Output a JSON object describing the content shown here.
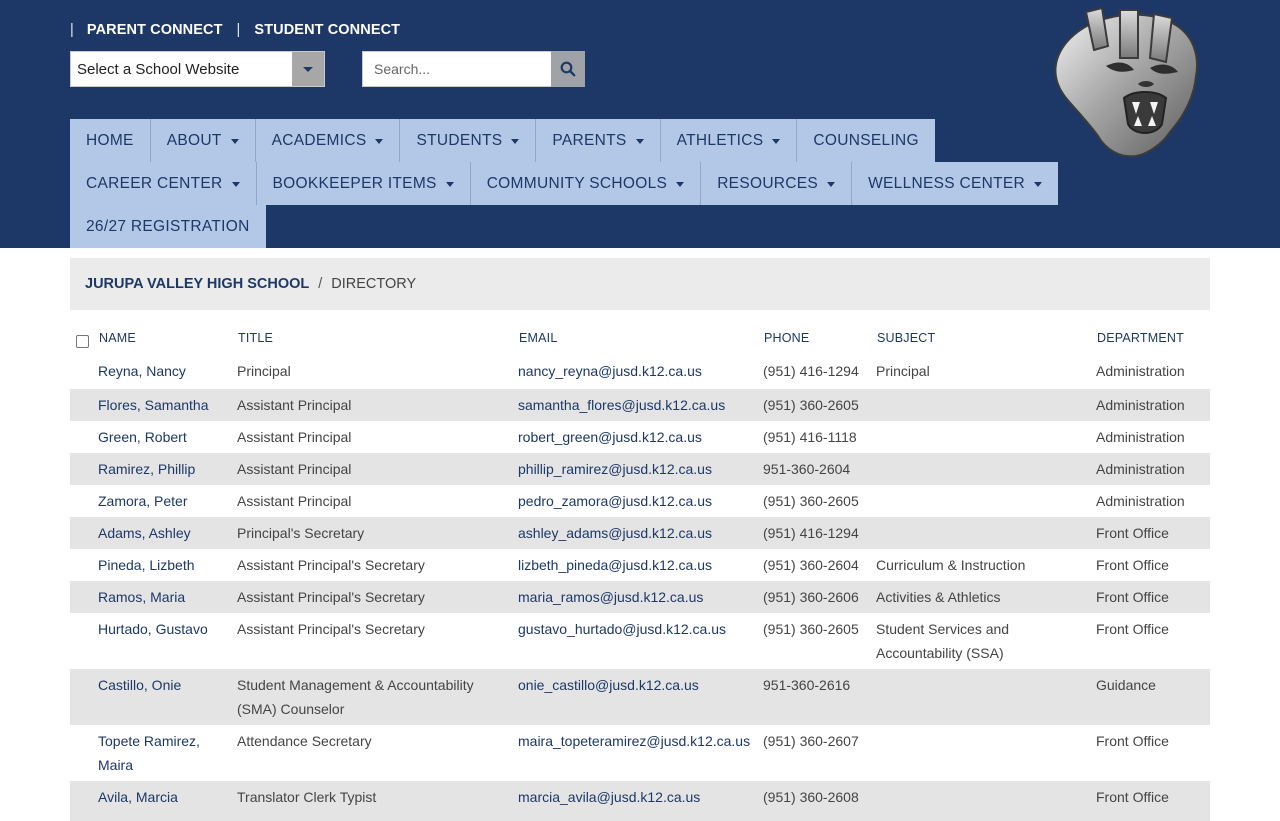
{
  "top_links": {
    "parent_connect": "PARENT CONNECT",
    "student_connect": "STUDENT CONNECT",
    "separator": "|"
  },
  "school_select": {
    "label": "Select a School Website"
  },
  "search": {
    "placeholder": "Search..."
  },
  "nav": {
    "row1": [
      {
        "label": "HOME",
        "dropdown": false
      },
      {
        "label": "ABOUT",
        "dropdown": true
      },
      {
        "label": "ACADEMICS",
        "dropdown": true
      },
      {
        "label": "STUDENTS",
        "dropdown": true
      },
      {
        "label": "PARENTS",
        "dropdown": true
      },
      {
        "label": "ATHLETICS",
        "dropdown": true
      },
      {
        "label": "COUNSELING",
        "dropdown": false
      }
    ],
    "row2": [
      {
        "label": "CAREER CENTER",
        "dropdown": true
      },
      {
        "label": "BOOKKEEPER ITEMS",
        "dropdown": true
      },
      {
        "label": "COMMUNITY SCHOOLS",
        "dropdown": true
      },
      {
        "label": "RESOURCES",
        "dropdown": true
      },
      {
        "label": "WELLNESS CENTER",
        "dropdown": true
      }
    ],
    "row3": [
      {
        "label": "26/27 REGISTRATION",
        "dropdown": false
      }
    ]
  },
  "breadcrumb": {
    "home": "JURUPA VALLEY HIGH SCHOOL",
    "separator": "/",
    "current": "DIRECTORY"
  },
  "directory": {
    "headers": [
      "NAME",
      "TITLE",
      "EMAIL",
      "PHONE",
      "SUBJECT",
      "DEPARTMENT"
    ],
    "rows": [
      {
        "name": "Reyna, Nancy",
        "title": "Principal",
        "email": "nancy_reyna@jusd.k12.ca.us",
        "phone": "(951) 416-1294",
        "subject": "Principal",
        "department": "Administration"
      },
      {
        "name": "Flores, Samantha",
        "title": "Assistant Principal",
        "email": "samantha_flores@jusd.k12.ca.us",
        "phone": "(951) 360-2605",
        "subject": "",
        "department": "Administration"
      },
      {
        "name": "Green, Robert",
        "title": "Assistant Principal",
        "email": "robert_green@jusd.k12.ca.us",
        "phone": "(951) 416-1118",
        "subject": "",
        "department": "Administration"
      },
      {
        "name": "Ramirez, Phillip",
        "title": "Assistant Principal",
        "email": "phillip_ramirez@jusd.k12.ca.us",
        "phone": "951-360-2604",
        "subject": "",
        "department": "Administration"
      },
      {
        "name": "Zamora, Peter",
        "title": "Assistant Principal",
        "email": "pedro_zamora@jusd.k12.ca.us",
        "phone": "(951) 360-2605",
        "subject": "",
        "department": "Administration"
      },
      {
        "name": "Adams, Ashley",
        "title": "Principal's Secretary",
        "email": "ashley_adams@jusd.k12.ca.us",
        "phone": "(951) 416-1294",
        "subject": "",
        "department": "Front Office"
      },
      {
        "name": "Pineda, Lizbeth",
        "title": "Assistant Principal's Secretary",
        "email": "lizbeth_pineda@jusd.k12.ca.us",
        "phone": "(951) 360-2604",
        "subject": "Curriculum & Instruction",
        "department": "Front Office"
      },
      {
        "name": "Ramos, Maria",
        "title": "Assistant Principal's Secretary",
        "email": "maria_ramos@jusd.k12.ca.us",
        "phone": "(951) 360-2606",
        "subject": "Activities & Athletics",
        "department": "Front Office"
      },
      {
        "name": "Hurtado, Gustavo",
        "title": "Assistant Principal's Secretary",
        "email": "gustavo_hurtado@jusd.k12.ca.us",
        "phone": "(951) 360-2605",
        "subject": "Student Services and Accountability (SSA)",
        "department": "Front Office"
      },
      {
        "name": "Castillo, Onie",
        "title": "Student Management & Accountability (SMA) Counselor",
        "email": "onie_castillo@jusd.k12.ca.us",
        "phone": "951-360-2616",
        "subject": "",
        "department": "Guidance"
      },
      {
        "name": "Topete Ramirez, Maira",
        "title": "Attendance Secretary",
        "email": "maira_topeteramirez@jusd.k12.ca.us",
        "phone": "(951) 360-2607",
        "subject": "",
        "department": "Front Office"
      },
      {
        "name": "Avila, Marcia",
        "title": "Translator Clerk Typist",
        "email": "marcia_avila@jusd.k12.ca.us",
        "phone": "(951) 360-2608",
        "subject": "",
        "department": "Front Office"
      }
    ]
  },
  "colors": {
    "header_bg": "#1d3867",
    "nav_bg": "#b3c8e7",
    "row_alt": "#e4e4e4",
    "link": "#1d3867"
  },
  "icons": {
    "search": "search-icon",
    "dropdown": "chevron-down-icon",
    "logo": "jaguar-mascot-logo"
  }
}
